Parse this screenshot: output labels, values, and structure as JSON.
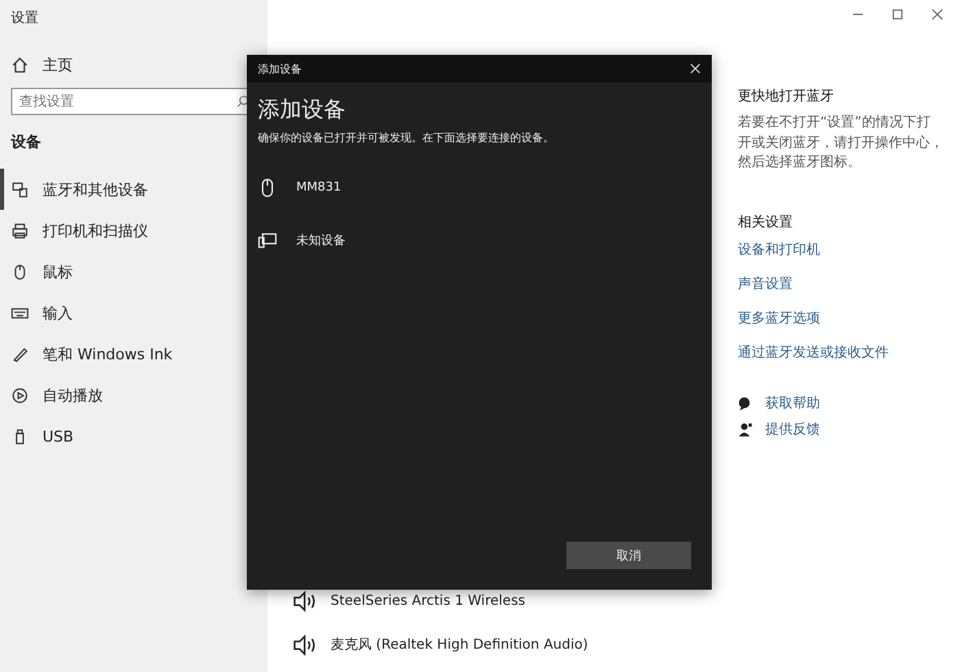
{
  "window": {
    "title": "设置"
  },
  "sidebar": {
    "home": "主页",
    "search": {
      "placeholder": "查找设置"
    },
    "section": "设备",
    "items": [
      {
        "label": "蓝牙和其他设备",
        "kind": "bluetooth",
        "selected": true
      },
      {
        "label": "打印机和扫描仪",
        "kind": "printer",
        "selected": false
      },
      {
        "label": "鼠标",
        "kind": "mouse",
        "selected": false
      },
      {
        "label": "输入",
        "kind": "keyboard",
        "selected": false
      },
      {
        "label": "笔和 Windows Ink",
        "kind": "pen",
        "selected": false
      },
      {
        "label": "自动播放",
        "kind": "autoplay",
        "selected": false
      },
      {
        "label": "USB",
        "kind": "usb",
        "selected": false
      }
    ]
  },
  "main": {
    "audio_devices": [
      {
        "name": "SteelSeries Arctis 1 Wireless"
      },
      {
        "name": "麦克风 (Realtek High Definition Audio)"
      }
    ]
  },
  "dialog": {
    "title": "添加设备",
    "heading": "添加设备",
    "description": "确保你的设备已打开并可被发现。在下面选择要连接的设备。",
    "devices": [
      {
        "name": "MM831",
        "kind": "mouse"
      },
      {
        "name": "未知设备",
        "kind": "display"
      }
    ],
    "cancel_button": "取消"
  },
  "right_panel": {
    "tip_heading": "更快地打开蓝牙",
    "tip_text": "若要在不打开“设置”的情况下打开或关闭蓝牙，请打开操作中心，然后选择蓝牙图标。",
    "related_heading": "相关设置",
    "related_links": [
      "设备和打印机",
      "声音设置",
      "更多蓝牙选项",
      "通过蓝牙发送或接收文件"
    ],
    "help_links": [
      {
        "label": "获取帮助",
        "kind": "help"
      },
      {
        "label": "提供反馈",
        "kind": "feedback"
      }
    ]
  }
}
